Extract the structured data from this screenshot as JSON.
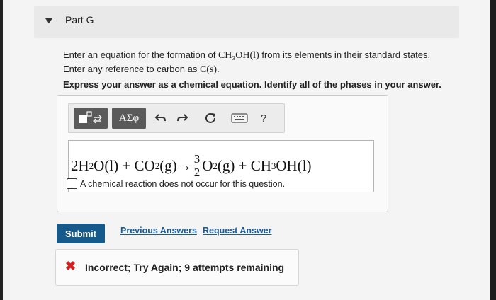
{
  "part": {
    "title": "Part G",
    "caret_icon": "caret-down-icon"
  },
  "question": {
    "prompt_before": "Enter an equation for the formation of ",
    "prompt_formula": "CH₃OH(l)",
    "prompt_middle": " from its elements in their standard states. Enter any reference to carbon as ",
    "prompt_carbon": "C(s)",
    "prompt_end": ".",
    "instruction": "Express your answer as a chemical equation. Identify all of the phases in your answer."
  },
  "toolbar": {
    "greek_label": "ΑΣφ",
    "help_label": "?",
    "icons": [
      "template-icon",
      "undo-icon",
      "redo-icon",
      "reset-icon",
      "keyboard-icon",
      "help-icon"
    ]
  },
  "equation": {
    "term1": "2H",
    "term1_sub": "2",
    "term1_rest": "O(l) + CO",
    "term2_sub": "2",
    "term2_rest": "(g)→",
    "frac_num": "3",
    "frac_den": "2",
    "term3": "O",
    "term3_sub": "2",
    "term3_rest": "(g) + CH",
    "term4_sub": "3",
    "term4_rest": "OH(l)"
  },
  "no_reaction": {
    "label": "A chemical reaction does not occur for this question.",
    "checked": false
  },
  "actions": {
    "submit": "Submit",
    "previous_answers": "Previous Answers",
    "request_answer": "Request Answer"
  },
  "feedback": {
    "icon": "x-icon",
    "color": "#d62020",
    "message": "Incorrect; Try Again; 9 attempts remaining"
  },
  "colors": {
    "submit_bg": "#155a8a",
    "link": "#1a5a96"
  }
}
